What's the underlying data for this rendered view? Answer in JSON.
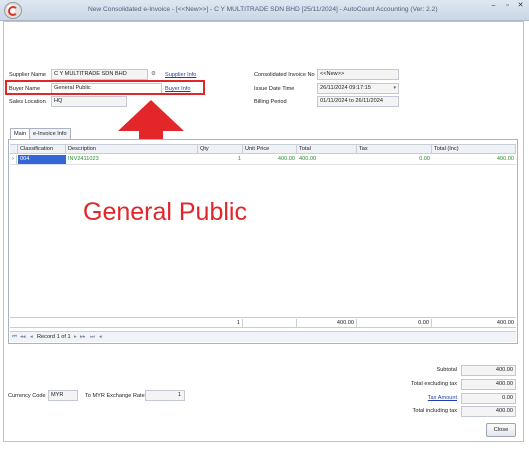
{
  "window": {
    "title": "New Consolidated e-Invoice - [<<New>>] - C Y MULTITRADE SDN BHD [25/11/2024] - AutoCount Accounting (Ver: 2.2)",
    "minimize": "–",
    "maximize": "▫",
    "close": "✕",
    "dropdown_caret": "▾"
  },
  "header": {
    "supplier_name_label": "Supplier Name",
    "supplier_name_value": "C Y MULTITRADE SDN BHD",
    "supplier_info_link": "Supplier Info",
    "buyer_name_label": "Buyer Name",
    "buyer_name_value": "General Public",
    "buyer_info_link": "Buyer Info",
    "sales_location_label": "Sales Location",
    "sales_location_value": "HQ",
    "consolidated_invoice_no_label": "Consolidated Invoice No",
    "consolidated_invoice_no_value": "<<New>>",
    "issue_date_time_label": "Issue Date Time",
    "issue_date_time_value": "26/11/2024 09:17:15",
    "billing_period_label": "Billing Period",
    "billing_period_value": "01/11/2024 to 26/11/2024"
  },
  "annotation": {
    "text": "General Public",
    "color": "#e2262a"
  },
  "tabs": [
    {
      "label": "Main"
    },
    {
      "label": "e-Invoice Info"
    }
  ],
  "grid": {
    "columns": [
      "Classification",
      "Description",
      "Qty",
      "Unit Price",
      "Total",
      "Tax",
      "Total (Inc)"
    ],
    "rows": [
      {
        "indicator": "›",
        "classification": "004",
        "description": "INV2411023",
        "qty": "1",
        "unit_price": "400.00",
        "total": "400.00",
        "tax": "0.00",
        "total_inc": "400.00"
      }
    ],
    "footer": {
      "qty": "1",
      "total": "400.00",
      "tax": "0.00",
      "total_inc": "400.00"
    }
  },
  "navigator": {
    "first": "⏮",
    "prev_page": "◂◂",
    "prev": "◂",
    "record_text": "Record 1 of 1",
    "next": "▸",
    "next_page": "▸▸",
    "last": "⏭",
    "scroll_left": "◂"
  },
  "currency": {
    "currency_code_label": "Currency Code",
    "currency_code_value": "MYR",
    "exchange_rate_label": "To MYR Exchange Rate",
    "exchange_rate_value": "1"
  },
  "summary": {
    "subtotal_label": "Subtotal",
    "subtotal_value": "400.00",
    "total_excl_label": "Total excluding tax",
    "total_excl_value": "400.00",
    "tax_amount_label": "Tax Amount",
    "tax_amount_value": "0.00",
    "total_incl_label": "Total including tax",
    "total_incl_value": "400.00"
  },
  "buttons": {
    "close_label": "Close"
  }
}
